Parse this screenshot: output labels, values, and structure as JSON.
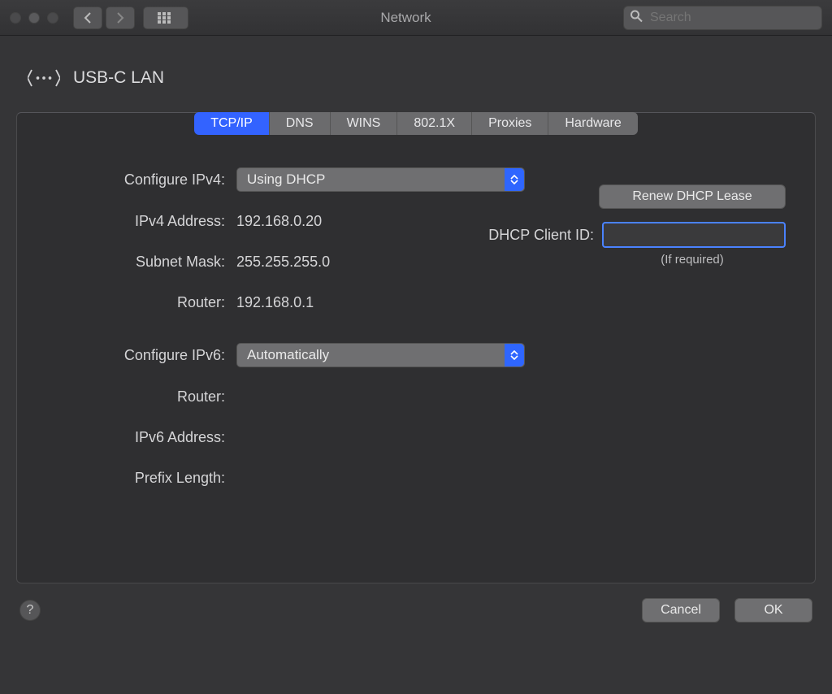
{
  "window": {
    "title": "Network",
    "search_placeholder": "Search"
  },
  "header": {
    "interface_name": "USB-C LAN"
  },
  "tabs": [
    {
      "id": "tcpip",
      "label": "TCP/IP",
      "active": true
    },
    {
      "id": "dns",
      "label": "DNS",
      "active": false
    },
    {
      "id": "wins",
      "label": "WINS",
      "active": false
    },
    {
      "id": "8021x",
      "label": "802.1X",
      "active": false
    },
    {
      "id": "proxies",
      "label": "Proxies",
      "active": false
    },
    {
      "id": "hardware",
      "label": "Hardware",
      "active": false
    }
  ],
  "ipv4": {
    "configure_label": "Configure IPv4:",
    "configure_value": "Using DHCP",
    "address_label": "IPv4 Address:",
    "address_value": "192.168.0.20",
    "subnet_label": "Subnet Mask:",
    "subnet_value": "255.255.255.0",
    "router_label": "Router:",
    "router_value": "192.168.0.1"
  },
  "dhcp": {
    "renew_label": "Renew DHCP Lease",
    "client_id_label": "DHCP Client ID:",
    "client_id_value": "",
    "hint": "(If required)"
  },
  "ipv6": {
    "configure_label": "Configure IPv6:",
    "configure_value": "Automatically",
    "router_label": "Router:",
    "router_value": "",
    "address_label": "IPv6 Address:",
    "address_value": "",
    "prefix_label": "Prefix Length:",
    "prefix_value": ""
  },
  "footer": {
    "cancel": "Cancel",
    "ok": "OK"
  }
}
